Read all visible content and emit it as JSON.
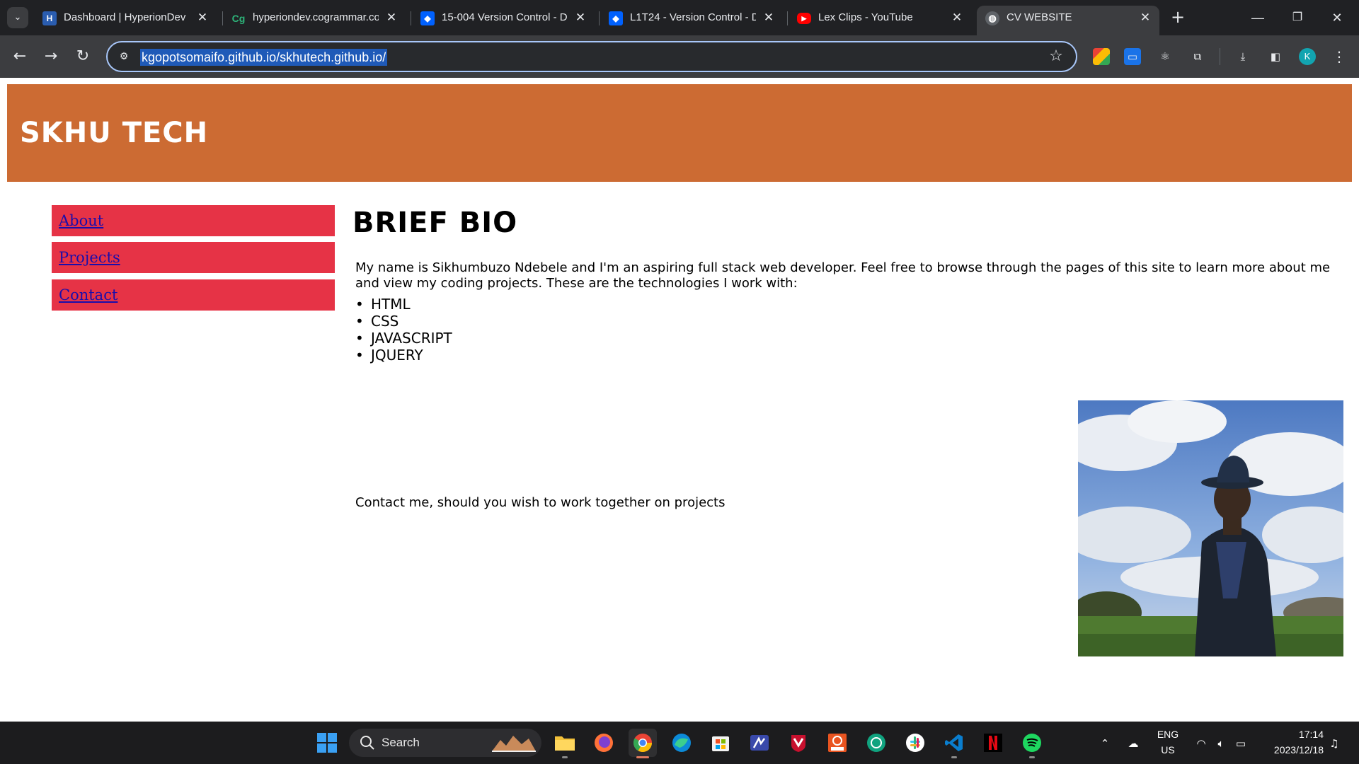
{
  "browser": {
    "tabs": [
      {
        "title": "Dashboard | HyperionDev",
        "favicon": "hyperiondev-icon",
        "color": "#2a5db0"
      },
      {
        "title": "hyperiondev.cogrammar.co",
        "favicon": "cogrammar-icon",
        "color": "#2db57a"
      },
      {
        "title": "15-004 Version Control - D",
        "favicon": "dropbox-icon",
        "color": "#0061fe"
      },
      {
        "title": "L1T24 - Version Control - D",
        "favicon": "dropbox-icon",
        "color": "#0061fe"
      },
      {
        "title": "Lex Clips - YouTube",
        "favicon": "youtube-icon",
        "color": "#ff0000"
      },
      {
        "title": "CV WEBSITE",
        "favicon": "globe-icon",
        "color": "#9aa0a6",
        "active": true
      }
    ],
    "url": "kgopotsomaifo.github.io/skhutech.github.io/",
    "profile_initial": "K"
  },
  "page": {
    "site_title": "SKHU TECH",
    "header_color": "#cc6b33",
    "nav": [
      {
        "label": "About"
      },
      {
        "label": "Projects"
      },
      {
        "label": "Contact"
      }
    ],
    "nav_color": "#e63346",
    "heading": "BRIEF BIO",
    "bio": "My name is Sikhumbuzo Ndebele and I'm an aspiring full stack web developer. Feel free to browse through the pages of this site to learn more about me and view my coding projects. These are the technologies I work with:",
    "technologies": [
      "HTML",
      "CSS",
      "JAVASCRIPT",
      "JQUERY"
    ],
    "contact_line": "Contact me, should you wish to work together on projects",
    "photo_alt": "profile-photo"
  },
  "taskbar": {
    "search_label": "Search",
    "language": "ENG",
    "region": "US",
    "time": "17:14",
    "date": "2023/12/18"
  }
}
